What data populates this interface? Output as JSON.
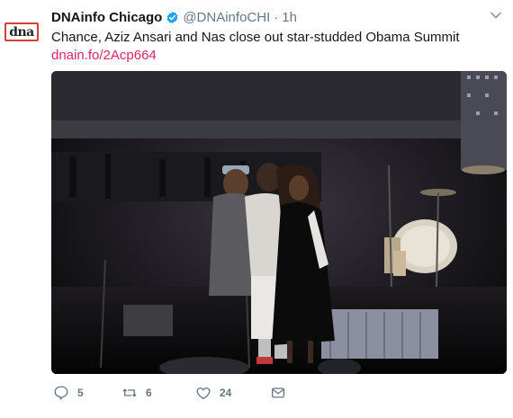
{
  "tweet": {
    "display_name": "DNAinfo Chicago",
    "handle": "@DNAinfoCHI",
    "separator": "·",
    "time": "1h",
    "text": "Chance, Aziz Ansari and Nas close out star-studded Obama Summit",
    "link": "dnain.fo/2Acp664",
    "avatar_text": "dna"
  },
  "actions": {
    "reply_count": "5",
    "retweet_count": "6",
    "like_count": "24"
  },
  "icons": {
    "verified": "verified-badge-icon",
    "caret": "chevron-down-icon",
    "reply": "reply-icon",
    "retweet": "retweet-icon",
    "like": "heart-icon",
    "dm": "envelope-icon"
  },
  "colors": {
    "link": "#e0245e",
    "verified": "#1da1f2",
    "secondary": "#657786",
    "avatar_border": "#d6403a"
  }
}
